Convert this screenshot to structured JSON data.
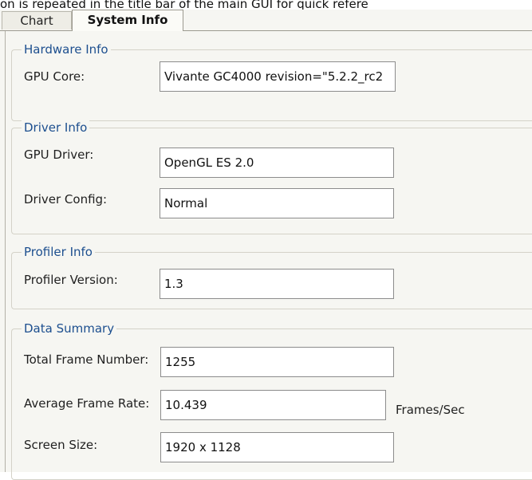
{
  "caption": "on is repeated in the title bar of the main GUI for quick refere",
  "tabs": {
    "chart": "Chart",
    "system_info": "System Info"
  },
  "hardware": {
    "legend": "Hardware Info",
    "gpu_core_label": "GPU Core:",
    "gpu_core_value": "Vivante GC4000 revision=\"5.2.2_rc2"
  },
  "driver": {
    "legend": "Driver Info",
    "gpu_driver_label": "GPU Driver:",
    "gpu_driver_value": "OpenGL ES 2.0",
    "driver_config_label": "Driver Config:",
    "driver_config_value": "Normal"
  },
  "profiler": {
    "legend": "Profiler Info",
    "version_label": "Profiler Version:",
    "version_value": "1.3"
  },
  "summary": {
    "legend": "Data Summary",
    "total_frames_label": "Total Frame Number:",
    "total_frames_value": "1255",
    "avg_rate_label": "Average Frame Rate:",
    "avg_rate_value": "10.439",
    "avg_rate_unit": "Frames/Sec",
    "screen_size_label": "Screen Size:",
    "screen_size_value": "1920 x 1128"
  }
}
